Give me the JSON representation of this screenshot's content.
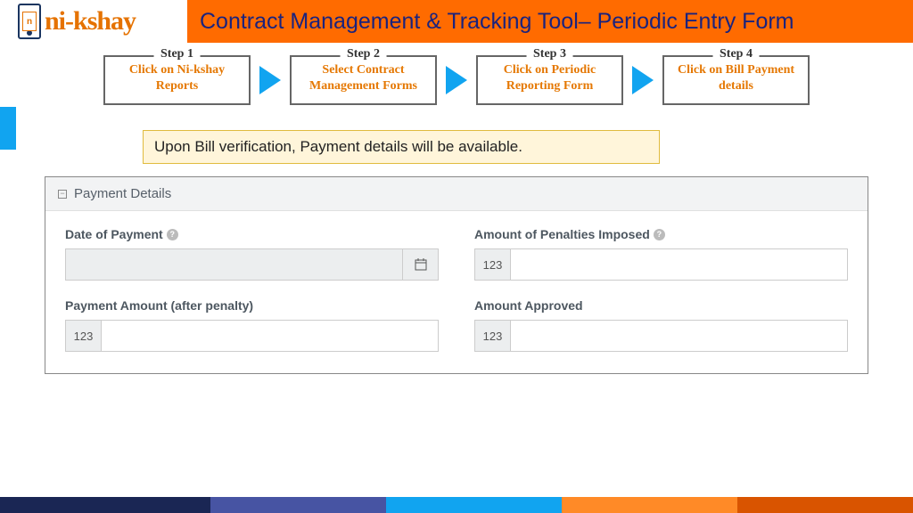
{
  "logo": {
    "text": "ni-kshay"
  },
  "header": {
    "title": "Contract Management & Tracking Tool– Periodic Entry Form"
  },
  "steps": [
    {
      "legend": "Step 1",
      "text": "Click on Ni-kshay Reports"
    },
    {
      "legend": "Step 2",
      "text": "Select Contract Management Forms"
    },
    {
      "legend": "Step 3",
      "text": "Click on Periodic Reporting Form"
    },
    {
      "legend": "Step 4",
      "text": "Click on Bill Payment details"
    }
  ],
  "callout": "Upon Bill verification, Payment details will be available.",
  "panel": {
    "title": "Payment Details",
    "fields": {
      "date_of_payment": {
        "label": "Date of Payment",
        "value": ""
      },
      "penalties": {
        "label": "Amount of Penalties Imposed",
        "prefix": "123",
        "value": ""
      },
      "payment_amount": {
        "label": "Payment Amount (after penalty)",
        "prefix": "123",
        "value": ""
      },
      "amount_approved": {
        "label": "Amount Approved",
        "prefix": "123",
        "value": ""
      }
    }
  }
}
